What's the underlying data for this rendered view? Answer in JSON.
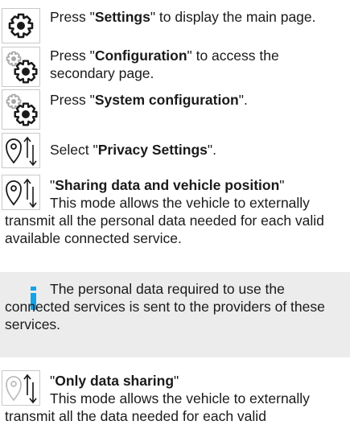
{
  "steps": [
    {
      "icon": "gear-icon",
      "pre": "Press \"",
      "bold": "Settings",
      "post": "\" to display the main page."
    },
    {
      "icon": "gears-icon",
      "pre": "Press \"",
      "bold": "Configuration",
      "post": "\" to access the secondary page."
    },
    {
      "icon": "gears-icon",
      "pre": "Press \"",
      "bold": "System configuration",
      "post": "\"."
    },
    {
      "icon": "location-arrows-icon",
      "pre": "Select \"",
      "bold": "Privacy Settings",
      "post": "\"."
    }
  ],
  "modes": [
    {
      "icon": "location-arrows-icon",
      "open": "\"",
      "title": "Sharing data and vehicle position",
      "close": "\"",
      "description": "This mode allows the vehicle to externally transmit all the personal data needed for each valid available connected service."
    },
    {
      "icon": "location-arrows-faded-icon",
      "open": "\"",
      "title": "Only data sharing",
      "close": "\"",
      "description": "This mode allows the vehicle to externally transmit all the data needed for each valid"
    }
  ],
  "note": {
    "icon": "info-icon",
    "text": "The personal data required to use the connected services is sent to the providers of these services."
  }
}
